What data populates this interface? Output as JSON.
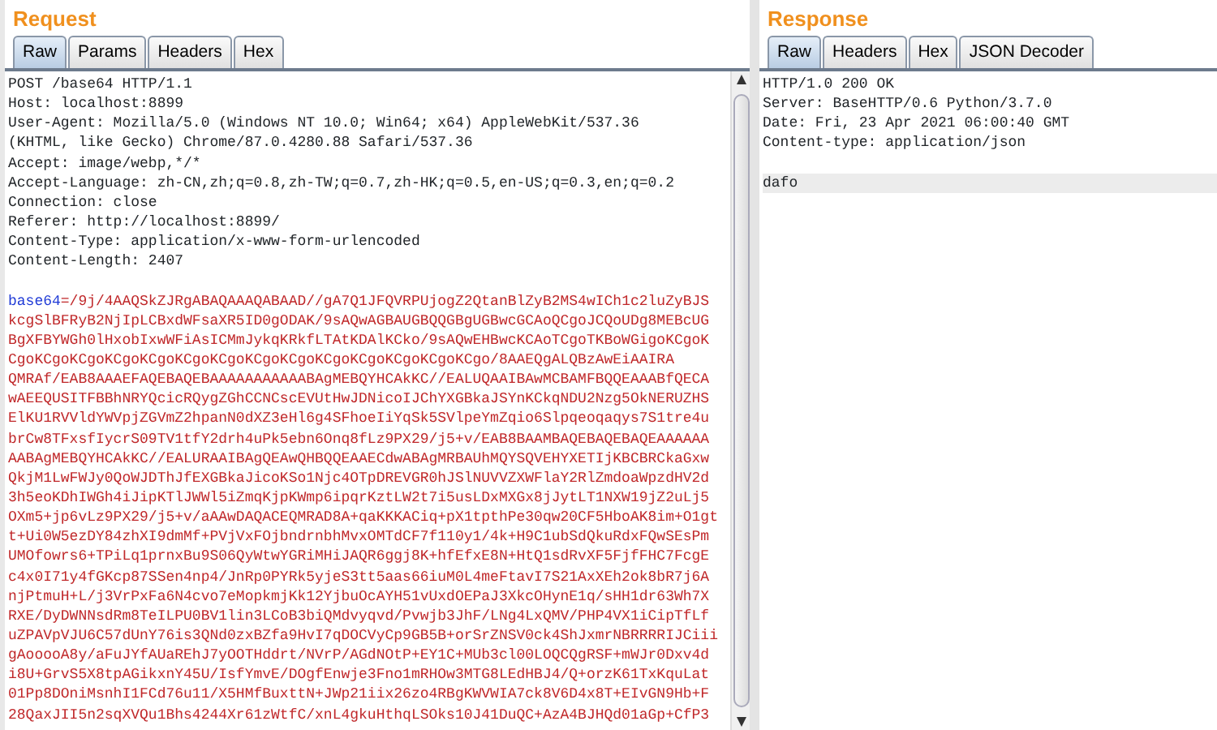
{
  "request": {
    "title": "Request",
    "tabs": [
      {
        "label": "Raw",
        "selected": true
      },
      {
        "label": "Params",
        "selected": false
      },
      {
        "label": "Headers",
        "selected": false
      },
      {
        "label": "Hex",
        "selected": false
      }
    ],
    "headers": [
      "POST /base64 HTTP/1.1",
      "Host: localhost:8899",
      "User-Agent: Mozilla/5.0 (Windows NT 10.0; Win64; x64) AppleWebKit/537.36",
      "(KHTML, like Gecko) Chrome/87.0.4280.88 Safari/537.36",
      "Accept: image/webp,*/*",
      "Accept-Language: zh-CN,zh;q=0.8,zh-TW;q=0.7,zh-HK;q=0.5,en-US;q=0.3,en;q=0.2",
      "Connection: close",
      "Referer: http://localhost:8899/",
      "Content-Type: application/x-www-form-urlencoded",
      "Content-Length: 2407"
    ],
    "body": {
      "param": "base64",
      "lines": [
        "=/9j/4AAQSkZJRgABAQAAAQABAAD//gA7Q1JFQVRPUjogZ2QtanBlZyB2MS4wICh1c2luZyBJS",
        "kcgSlBFRyB2NjIpLCBxdWFsaXR5ID0gODAK/9sAQwAGBAUGBQQGBgUGBwcGCAoQCgoJCQoUDg8MEBcUG",
        "BgXFBYWGh0lHxobIxwWFiAsICMmJykqKRkfLTAtKDAlKCko/9sAQwEHBwcKCAoTCgoTKBoWGigoKCgoK",
        "CgoKCgoKCgoKCgoKCgoKCgoKCgoKCgoKCgoKCgoKCgoKCgoKCgoKCgo/8AAEQgALQBzAwEiAAIRA",
        "QMRAf/EAB8AAAEFAQEBAQEBAAAAAAAAAAABAgMEBQYHCAkKC//EALUQAAIBAwMCBAMFBQQEAAABfQECA",
        "wAEEQUSITFBBhNRYQcicRQygZGhCCNCscEVUtHwJDNicoIJChYXGBkaJSYnKCkqNDU2Nzg5OkNERUZHS",
        "ElKU1RVVldYWVpjZGVmZ2hpanN0dXZ3eHl6g4SFhoeIiYqSk5SVlpeYmZqio6Slpqeoqaqys7S1tre4u",
        "brCw8TFxsfIycrS09TV1tfY2drh4uPk5ebn6Onq8fLz9PX29/j5+v/EAB8BAAMBAQEBAQEBAQEAAAAAA",
        "AABAgMEBQYHCAkKC//EALURAAIBAgQEAwQHBQQEAAECdwABAgMRBAUhMQYSQVEHYXETIjKBCBRCkaGxw",
        "QkjM1LwFWJy0QoWJDThJfEXGBkaJicoKSo1Njc4OTpDREVGR0hJSlNUVVZXWFlaY2RlZmdoaWpzdHV2d",
        "3h5eoKDhIWGh4iJipKTlJWWl5iZmqKjpKWmp6ipqrKztLW2t7i5usLDxMXGx8jJytLT1NXW19jZ2uLj5",
        "OXm5+jp6vLz9PX29/j5+v/aAAwDAQACEQMRAD8A+qaKKKACiq+pX1tpthPe30qw20CF5HboAK8im+O1gt",
        "t+Ui0W5ezDY84zhXI9dmMf+PVjVxFOjbndrnbhMvxOMTdCF7f110y1/4k+H9C1ubSdQkuRdxFQwSEsPm",
        "UMOfowrs6+TPiLq1prnxBu9S06QyWtwYGRiMHiJAQR6ggj8K+hfEfxE8N+HtQ1sdRvXF5FjfFHC7FcgE",
        "c4x0I71y4fGKcp87SSen4np4/JnRp0PYRk5yjeS3tt5aas66iuM0L4meFtavI7S21AxXEh2ok8bR7j6A",
        "njPtmuH+L/j3VrPxFa6N4cvo7eMopkmjKk12YjbuOcAYH51vUxdOEPaJ3XkcOHynE1q/sHH1dr63Wh7X",
        "RXE/DyDWNNsdRm8TeILPU0BV1lin3LCoB3biQMdvyqvd/Pvwjb3JhF/LNg4LxQMV/PHP4VX1iCipTfLf",
        "uZPAVpVJU6C57dUnY76is3QNd0zxBZfa9HvI7qDOCVyCp9GB5B+orSrZNSV0ck4ShJxmrNBRRRRIJCiii",
        "gAooooA8y/aFuJYfAUaREhJ7yOOTHddrt/NVrP/AGdNOtP+EY1C+MUb3cl00LOQCQgRSF+mWJr0Dxv4d",
        "i8U+GrvS5X8tpAGikxnY45U/IsfYmvE/DOgfEnwje3Fno1mRHOw3MTG8LEdHBJ4/Q+orzK61TxKquLat",
        "01Pp8DOniMsnhI1FCd76u11/X5HMfBuxttN+JWp21iix26zo4RBgKWVWIA7ck8V6D4x8T+EIvGN9Hb+F",
        "28QaxJII5n2sqXVQu1Bhs4244Xr61zWtfC/xnL4gkuHthqLSOks10J41DuQC+AzA4BJHQd01aGp+CfP3"
      ]
    }
  },
  "response": {
    "title": "Response",
    "tabs": [
      {
        "label": "Raw",
        "selected": true
      },
      {
        "label": "Headers",
        "selected": false
      },
      {
        "label": "Hex",
        "selected": false
      },
      {
        "label": "JSON Decoder",
        "selected": false
      }
    ],
    "headers": [
      "HTTP/1.0 200 OK",
      "Server: BaseHTTP/0.6 Python/3.7.0",
      "Date: Fri, 23 Apr 2021 06:00:40 GMT",
      "Content-type: application/json"
    ],
    "body": "dafo"
  }
}
